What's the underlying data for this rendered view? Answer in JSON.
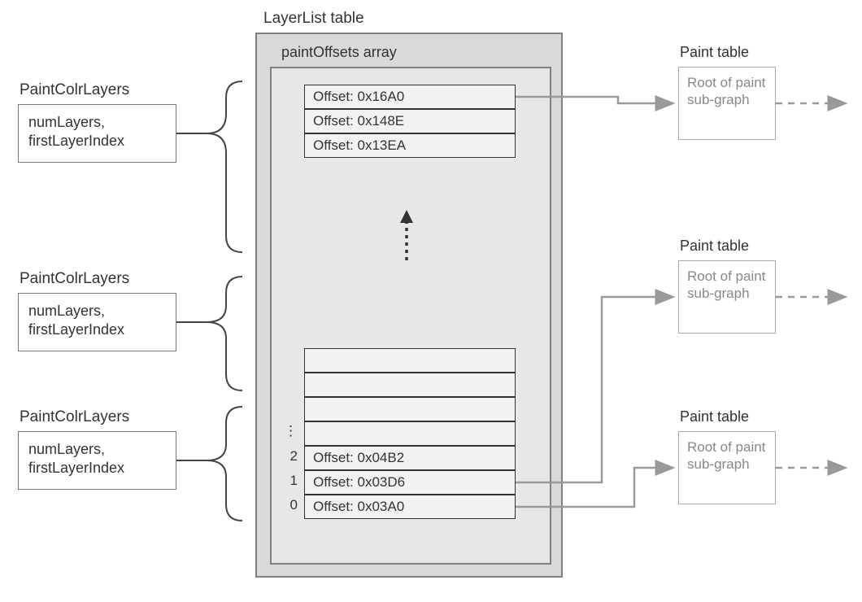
{
  "titles": {
    "layerlist": "LayerList table",
    "paintoffsets": "paintOffsets array"
  },
  "left_blocks": [
    {
      "title": "PaintColrLayers",
      "content": "numLayers,\nfirstLayerIndex"
    },
    {
      "title": "PaintColrLayers",
      "content": "numLayers,\nfirstLayerIndex"
    },
    {
      "title": "PaintColrLayers",
      "content": "numLayers,\nfirstLayerIndex"
    }
  ],
  "offsets_top": [
    "Offset: 0x16A0",
    "Offset: 0x148E",
    "Offset: 0x13EA"
  ],
  "offsets_bottom_indices": [
    "⋮",
    "2",
    "1",
    "0"
  ],
  "offsets_bottom": [
    "",
    "",
    "",
    "",
    "Offset: 0x04B2",
    "Offset: 0x03D6",
    "Offset: 0x03A0"
  ],
  "paint_tables": [
    {
      "title": "Paint table",
      "content": "Root of\npaint\nsub-graph"
    },
    {
      "title": "Paint table",
      "content": "Root of\npaint\nsub-graph"
    },
    {
      "title": "Paint table",
      "content": "Root of\npaint\nsub-graph"
    }
  ]
}
